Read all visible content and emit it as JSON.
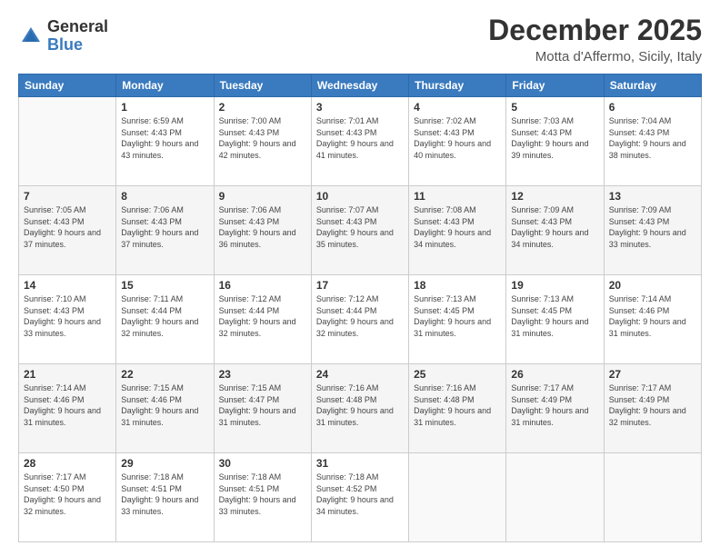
{
  "header": {
    "logo": {
      "general": "General",
      "blue": "Blue"
    },
    "title": "December 2025",
    "location": "Motta d'Affermo, Sicily, Italy"
  },
  "days_of_week": [
    "Sunday",
    "Monday",
    "Tuesday",
    "Wednesday",
    "Thursday",
    "Friday",
    "Saturday"
  ],
  "weeks": [
    [
      {
        "day": "",
        "sunrise": "",
        "sunset": "",
        "daylight": "",
        "empty": true
      },
      {
        "day": "1",
        "sunrise": "Sunrise: 6:59 AM",
        "sunset": "Sunset: 4:43 PM",
        "daylight": "Daylight: 9 hours and 43 minutes."
      },
      {
        "day": "2",
        "sunrise": "Sunrise: 7:00 AM",
        "sunset": "Sunset: 4:43 PM",
        "daylight": "Daylight: 9 hours and 42 minutes."
      },
      {
        "day": "3",
        "sunrise": "Sunrise: 7:01 AM",
        "sunset": "Sunset: 4:43 PM",
        "daylight": "Daylight: 9 hours and 41 minutes."
      },
      {
        "day": "4",
        "sunrise": "Sunrise: 7:02 AM",
        "sunset": "Sunset: 4:43 PM",
        "daylight": "Daylight: 9 hours and 40 minutes."
      },
      {
        "day": "5",
        "sunrise": "Sunrise: 7:03 AM",
        "sunset": "Sunset: 4:43 PM",
        "daylight": "Daylight: 9 hours and 39 minutes."
      },
      {
        "day": "6",
        "sunrise": "Sunrise: 7:04 AM",
        "sunset": "Sunset: 4:43 PM",
        "daylight": "Daylight: 9 hours and 38 minutes."
      }
    ],
    [
      {
        "day": "7",
        "sunrise": "Sunrise: 7:05 AM",
        "sunset": "Sunset: 4:43 PM",
        "daylight": "Daylight: 9 hours and 37 minutes."
      },
      {
        "day": "8",
        "sunrise": "Sunrise: 7:06 AM",
        "sunset": "Sunset: 4:43 PM",
        "daylight": "Daylight: 9 hours and 37 minutes."
      },
      {
        "day": "9",
        "sunrise": "Sunrise: 7:06 AM",
        "sunset": "Sunset: 4:43 PM",
        "daylight": "Daylight: 9 hours and 36 minutes."
      },
      {
        "day": "10",
        "sunrise": "Sunrise: 7:07 AM",
        "sunset": "Sunset: 4:43 PM",
        "daylight": "Daylight: 9 hours and 35 minutes."
      },
      {
        "day": "11",
        "sunrise": "Sunrise: 7:08 AM",
        "sunset": "Sunset: 4:43 PM",
        "daylight": "Daylight: 9 hours and 34 minutes."
      },
      {
        "day": "12",
        "sunrise": "Sunrise: 7:09 AM",
        "sunset": "Sunset: 4:43 PM",
        "daylight": "Daylight: 9 hours and 34 minutes."
      },
      {
        "day": "13",
        "sunrise": "Sunrise: 7:09 AM",
        "sunset": "Sunset: 4:43 PM",
        "daylight": "Daylight: 9 hours and 33 minutes."
      }
    ],
    [
      {
        "day": "14",
        "sunrise": "Sunrise: 7:10 AM",
        "sunset": "Sunset: 4:43 PM",
        "daylight": "Daylight: 9 hours and 33 minutes."
      },
      {
        "day": "15",
        "sunrise": "Sunrise: 7:11 AM",
        "sunset": "Sunset: 4:44 PM",
        "daylight": "Daylight: 9 hours and 32 minutes."
      },
      {
        "day": "16",
        "sunrise": "Sunrise: 7:12 AM",
        "sunset": "Sunset: 4:44 PM",
        "daylight": "Daylight: 9 hours and 32 minutes."
      },
      {
        "day": "17",
        "sunrise": "Sunrise: 7:12 AM",
        "sunset": "Sunset: 4:44 PM",
        "daylight": "Daylight: 9 hours and 32 minutes."
      },
      {
        "day": "18",
        "sunrise": "Sunrise: 7:13 AM",
        "sunset": "Sunset: 4:45 PM",
        "daylight": "Daylight: 9 hours and 31 minutes."
      },
      {
        "day": "19",
        "sunrise": "Sunrise: 7:13 AM",
        "sunset": "Sunset: 4:45 PM",
        "daylight": "Daylight: 9 hours and 31 minutes."
      },
      {
        "day": "20",
        "sunrise": "Sunrise: 7:14 AM",
        "sunset": "Sunset: 4:46 PM",
        "daylight": "Daylight: 9 hours and 31 minutes."
      }
    ],
    [
      {
        "day": "21",
        "sunrise": "Sunrise: 7:14 AM",
        "sunset": "Sunset: 4:46 PM",
        "daylight": "Daylight: 9 hours and 31 minutes."
      },
      {
        "day": "22",
        "sunrise": "Sunrise: 7:15 AM",
        "sunset": "Sunset: 4:46 PM",
        "daylight": "Daylight: 9 hours and 31 minutes."
      },
      {
        "day": "23",
        "sunrise": "Sunrise: 7:15 AM",
        "sunset": "Sunset: 4:47 PM",
        "daylight": "Daylight: 9 hours and 31 minutes."
      },
      {
        "day": "24",
        "sunrise": "Sunrise: 7:16 AM",
        "sunset": "Sunset: 4:48 PM",
        "daylight": "Daylight: 9 hours and 31 minutes."
      },
      {
        "day": "25",
        "sunrise": "Sunrise: 7:16 AM",
        "sunset": "Sunset: 4:48 PM",
        "daylight": "Daylight: 9 hours and 31 minutes."
      },
      {
        "day": "26",
        "sunrise": "Sunrise: 7:17 AM",
        "sunset": "Sunset: 4:49 PM",
        "daylight": "Daylight: 9 hours and 31 minutes."
      },
      {
        "day": "27",
        "sunrise": "Sunrise: 7:17 AM",
        "sunset": "Sunset: 4:49 PM",
        "daylight": "Daylight: 9 hours and 32 minutes."
      }
    ],
    [
      {
        "day": "28",
        "sunrise": "Sunrise: 7:17 AM",
        "sunset": "Sunset: 4:50 PM",
        "daylight": "Daylight: 9 hours and 32 minutes."
      },
      {
        "day": "29",
        "sunrise": "Sunrise: 7:18 AM",
        "sunset": "Sunset: 4:51 PM",
        "daylight": "Daylight: 9 hours and 33 minutes."
      },
      {
        "day": "30",
        "sunrise": "Sunrise: 7:18 AM",
        "sunset": "Sunset: 4:51 PM",
        "daylight": "Daylight: 9 hours and 33 minutes."
      },
      {
        "day": "31",
        "sunrise": "Sunrise: 7:18 AM",
        "sunset": "Sunset: 4:52 PM",
        "daylight": "Daylight: 9 hours and 34 minutes."
      },
      {
        "day": "",
        "sunrise": "",
        "sunset": "",
        "daylight": "",
        "empty": true
      },
      {
        "day": "",
        "sunrise": "",
        "sunset": "",
        "daylight": "",
        "empty": true
      },
      {
        "day": "",
        "sunrise": "",
        "sunset": "",
        "daylight": "",
        "empty": true
      }
    ]
  ]
}
